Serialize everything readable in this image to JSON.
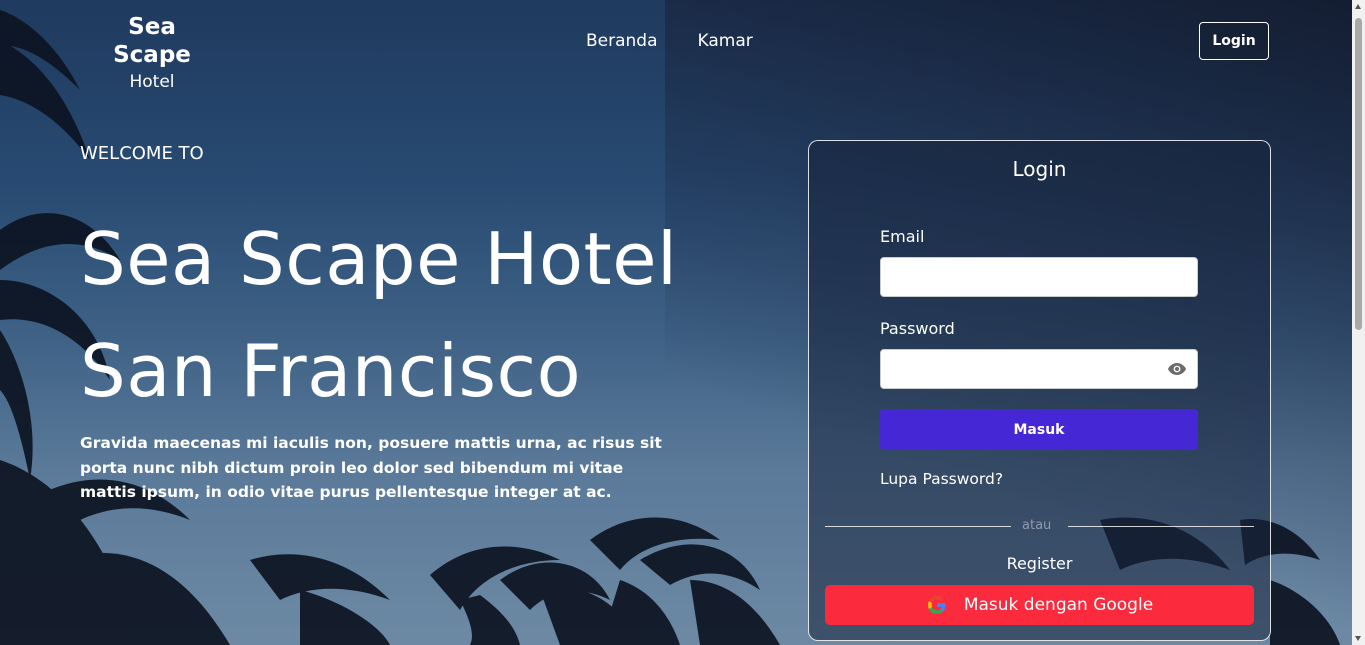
{
  "brand": {
    "name": "Sea Scape",
    "sub": "Hotel"
  },
  "nav": {
    "items": [
      "Beranda",
      "Kamar"
    ]
  },
  "header": {
    "login_label": "Login"
  },
  "hero": {
    "welcome": "WELCOME TO",
    "title_line1": "Sea Scape Hotel",
    "title_line2": "San Francisco",
    "description": "Gravida maecenas mi iaculis non, posuere mattis urna, ac risus sit porta nunc nibh dictum proin leo dolor sed bibendum mi vitae mattis ipsum, in odio vitae purus pellentesque integer at ac."
  },
  "login_form": {
    "title": "Login",
    "email_label": "Email",
    "email_value": "",
    "password_label": "Password",
    "password_value": "",
    "submit_label": "Masuk",
    "forgot_label": "Lupa Password?",
    "divider_text": "atau",
    "register_label": "Register",
    "google_label": "Masuk dengan Google",
    "eye_icon": "eye-icon",
    "google_icon": "google-icon"
  },
  "colors": {
    "submit": "#4527d6",
    "google_button": "#fb2a3c",
    "accent_text": "#ffffff"
  }
}
